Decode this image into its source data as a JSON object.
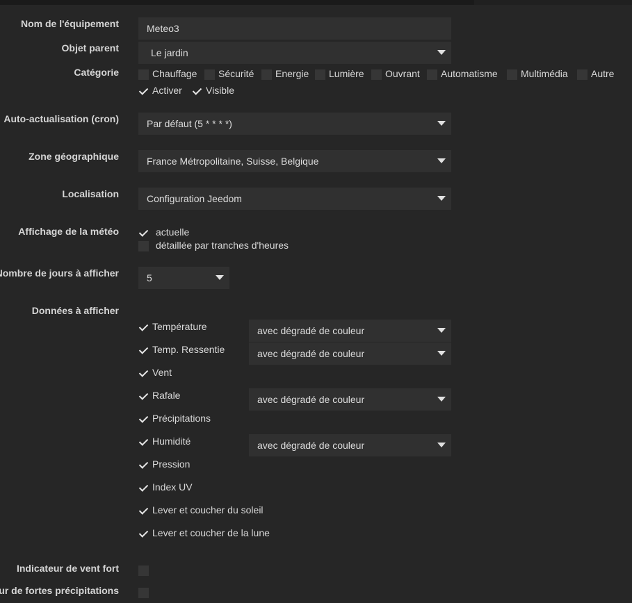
{
  "form": {
    "equipment_name_label": "Nom de l'équipement",
    "equipment_name_value": "Meteo3",
    "parent_label": "Objet parent",
    "parent_value": "Le jardin",
    "category_label": "Catégorie",
    "categories": [
      {
        "label": "Chauffage",
        "checked": false
      },
      {
        "label": "Sécurité",
        "checked": false
      },
      {
        "label": "Energie",
        "checked": false
      },
      {
        "label": "Lumière",
        "checked": false
      },
      {
        "label": "Ouvrant",
        "checked": false
      },
      {
        "label": "Automatisme",
        "checked": false
      },
      {
        "label": "Multimédia",
        "checked": false
      },
      {
        "label": "Autre",
        "checked": false
      }
    ],
    "activer_label": "Activer",
    "visible_label": "Visible",
    "cron_label": "Auto-actualisation (cron)",
    "cron_value": "Par défaut (5 * * * *)",
    "zone_label": "Zone géographique",
    "zone_value": "France Métropolitaine, Suisse, Belgique",
    "localisation_label": "Localisation",
    "localisation_value": "Configuration Jeedom",
    "affichage_label": "Affichage de la météo",
    "affichage_options": [
      {
        "label": "actuelle",
        "checked": true
      },
      {
        "label": "détaillée par tranches d'heures",
        "checked": false
      }
    ],
    "jours_label": "Nombre de jours à afficher",
    "jours_value": "5",
    "donnees_label": "Données à afficher",
    "donnees": [
      {
        "label": "Température",
        "checked": true,
        "mode": "avec dégradé de couleur"
      },
      {
        "label": "Temp. Ressentie",
        "checked": true,
        "mode": "avec dégradé de couleur"
      },
      {
        "label": "Vent",
        "checked": true
      },
      {
        "label": "Rafale",
        "checked": true,
        "mode": "avec dégradé de couleur"
      },
      {
        "label": "Précipitations",
        "checked": true
      },
      {
        "label": "Humidité",
        "checked": true,
        "mode": "avec dégradé de couleur"
      },
      {
        "label": "Pression",
        "checked": true
      },
      {
        "label": "Index UV",
        "checked": true
      },
      {
        "label": "Lever et coucher du soleil",
        "checked": true
      },
      {
        "label": "Lever et coucher de la lune",
        "checked": true
      }
    ],
    "vent_fort_label": "Indicateur de vent fort",
    "fortes_precip_label": "teur de fortes précipitations"
  }
}
